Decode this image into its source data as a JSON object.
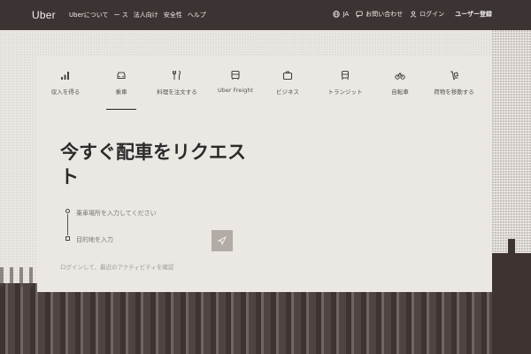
{
  "header": {
    "logo": "Uber",
    "nav": [
      "Uberについて",
      "ー ス",
      "法人向け",
      "安全性",
      "ヘルプ"
    ],
    "language": "JA",
    "support_label": "お問い合わせ",
    "login_label": "ログイン",
    "signup_label": "ユーザー登録"
  },
  "tabs": [
    {
      "label": "収入を得る",
      "icon": "bar-chart-icon"
    },
    {
      "label": "乗車",
      "icon": "car-icon",
      "active": true
    },
    {
      "label": "料理を注文する",
      "icon": "utensils-icon"
    },
    {
      "label": "Uber Freight",
      "icon": "truck-icon"
    },
    {
      "label": "ビジネス",
      "icon": "briefcase-icon"
    },
    {
      "label": "トランジット",
      "icon": "train-icon"
    },
    {
      "label": "自転車",
      "icon": "bicycle-icon"
    },
    {
      "label": "荷物を移動する",
      "icon": "dolly-icon"
    }
  ],
  "main": {
    "title": "今すぐ配車をリクエスト",
    "pickup_placeholder": "乗車場所を入力してください",
    "dropoff_placeholder": "目的地を入力",
    "hint": "ログインして、最近のアクティビティを確認"
  },
  "colors": {
    "topbar": "#3b3432",
    "card": "#ebe8e3",
    "accent": "#222222"
  }
}
